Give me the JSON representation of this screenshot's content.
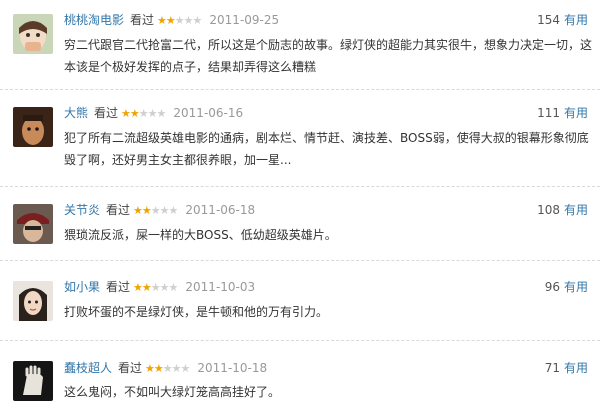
{
  "colors": {
    "link": "#3377aa",
    "star_on": "#f0a400",
    "star_off": "#cfcfcf",
    "date": "#999999"
  },
  "icons": [
    "star-filled-icon",
    "star-empty-icon"
  ],
  "reviews": [
    {
      "user": "桃桃淘电影",
      "watched": "看过",
      "rating": 2,
      "date": "2011-09-25",
      "useful_count": "154",
      "useful_label": "有用",
      "text": "穷二代跟官二代抢富二代，所以这是个励志的故事。绿灯侠的超能力其实很牛，想象力决定一切，这本该是个极好发挥的点子，结果却弄得这么糟糕"
    },
    {
      "user": "大熊",
      "watched": "看过",
      "rating": 2,
      "date": "2011-06-16",
      "useful_count": "111",
      "useful_label": "有用",
      "text": "犯了所有二流超级英雄电影的通病，剧本烂、情节赶、演技差、BOSS弱，使得大叔的银幕形象彻底毁了啊，还好男主女主都很养眼，加一星..."
    },
    {
      "user": "关节炎",
      "watched": "看过",
      "rating": 2,
      "date": "2011-06-18",
      "useful_count": "108",
      "useful_label": "有用",
      "text": "猥琐流反派，屎一样的大BOSS、低幼超级英雄片。"
    },
    {
      "user": "如小果",
      "watched": "看过",
      "rating": 2,
      "date": "2011-10-03",
      "useful_count": "96",
      "useful_label": "有用",
      "text": "打败坏蛋的不是绿灯侠，是牛顿和他的万有引力。"
    },
    {
      "user": "蠢枝超人",
      "watched": "看过",
      "rating": 2,
      "date": "2011-10-18",
      "useful_count": "71",
      "useful_label": "有用",
      "text": "这么鬼闷，不如叫大绿灯笼高高挂好了。"
    }
  ]
}
